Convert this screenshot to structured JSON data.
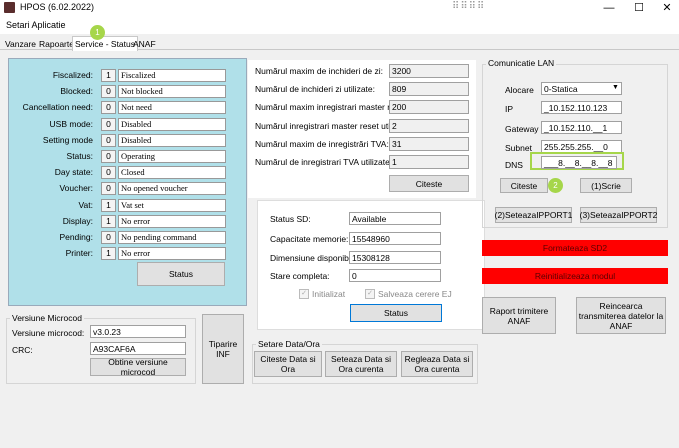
{
  "window": {
    "title": "HPOS (6.02.2022)",
    "dots": "⠿⠿⠿⠿",
    "minimize": "—",
    "maximize": "☐",
    "close": "✕"
  },
  "menu": {
    "settings": "Setari Aplicatie"
  },
  "tabs": [
    {
      "label": "Vanzare"
    },
    {
      "label": "Rapoarte"
    },
    {
      "label": "Service - Status"
    },
    {
      "label": "ANAF"
    }
  ],
  "badges": {
    "one": "1",
    "two": "2"
  },
  "status": {
    "rows": [
      {
        "label": "Fiscalized:",
        "num": "1",
        "value": "Fiscalized"
      },
      {
        "label": "Blocked:",
        "num": "0",
        "value": "Not blocked"
      },
      {
        "label": "Cancellation need:",
        "num": "0",
        "value": "Not need"
      },
      {
        "label": "USB mode:",
        "num": "0",
        "value": "Disabled"
      },
      {
        "label": "Setting mode",
        "num": "0",
        "value": "Disabled"
      },
      {
        "label": "Status:",
        "num": "0",
        "value": "Operating"
      },
      {
        "label": "Day state:",
        "num": "0",
        "value": "Closed"
      },
      {
        "label": "Voucher:",
        "num": "0",
        "value": "No opened voucher"
      },
      {
        "label": "Vat:",
        "num": "1",
        "value": "Vat set"
      },
      {
        "label": "Display:",
        "num": "1",
        "value": "No error"
      },
      {
        "label": "Pending:",
        "num": "0",
        "value": "No pending command"
      },
      {
        "label": "Printer:",
        "num": "1",
        "value": "No error"
      }
    ],
    "button": "Status"
  },
  "counters": {
    "rows": [
      {
        "label": "Numărul maxim de inchideri de zi:",
        "value": "3200"
      },
      {
        "label": "Numărul de inchideri zi utilizate:",
        "value": "809"
      },
      {
        "label": "Numărul maxim inregistrari master reset:",
        "value": "200"
      },
      {
        "label": "Numărul inregistrari master reset utilizate:",
        "value": "2"
      },
      {
        "label": "Numărul maxim de inregistrări TVA:",
        "value": "31"
      },
      {
        "label": "Numărul de inregistrari TVA utilizate:",
        "value": "1"
      }
    ],
    "read_button": "Citeste"
  },
  "sd": {
    "status_label": "Status SD:",
    "status_value": "Available",
    "capacity_label": "Capacitate memorie:",
    "capacity_value": "15548960",
    "available_label": "Dimensiune disponibila:",
    "available_value": "15308128",
    "complete_label": "Stare completa:",
    "complete_value": "0",
    "initialized_label": "Initializat",
    "save_ej_label": "Salveaza cerere EJ",
    "button": "Status"
  },
  "lan": {
    "title": "Comunicatie LAN",
    "alloc_label": "Alocare",
    "alloc_value": "0-Statica",
    "ip_label": "IP",
    "ip_value": "_10.152.110.123",
    "gateway_label": "Gateway",
    "gateway_value": "_10.152.110.__1",
    "subnet_label": "Subnet",
    "subnet_value": "255.255.255.__0",
    "dns_label": "DNS",
    "dns_value": "___8.__8.__8.__8",
    "read_button": "Citeste",
    "write_button": "(1)Scrie",
    "ipport2_button": "(2)SeteazaIPPORT1",
    "ipport3_button": "(3)SeteazaIPPORT2"
  },
  "sd_actions": {
    "format_sd": "Formateaza SD2",
    "init_module": "Reinitializeaza modul"
  },
  "anaf": {
    "report_button": "Raport trimitere ANAF",
    "reload_button": "Reincearca transmiterea datelor la ANAF"
  },
  "firmware": {
    "title": "Versiune Microcod",
    "version_label": "Versiune microcod:",
    "version_value": "v3.0.23",
    "crc_label": "CRC:",
    "crc_value": "A93CAF6A",
    "get_button": "Obtine versiune microcod",
    "print_button": "Tiparire INF"
  },
  "datetime": {
    "title": "Setare Data/Ora",
    "read_button": "Citeste Data si Ora",
    "set_button": "Seteaza Data si Ora curenta",
    "adjust_button": "Regleaza Data si Ora curenta"
  },
  "colors": {
    "panel_bg": "#b0e0e9",
    "badge": "#a6d64a",
    "alert_red": "#ff0000",
    "accent_blue": "#0078d7"
  }
}
